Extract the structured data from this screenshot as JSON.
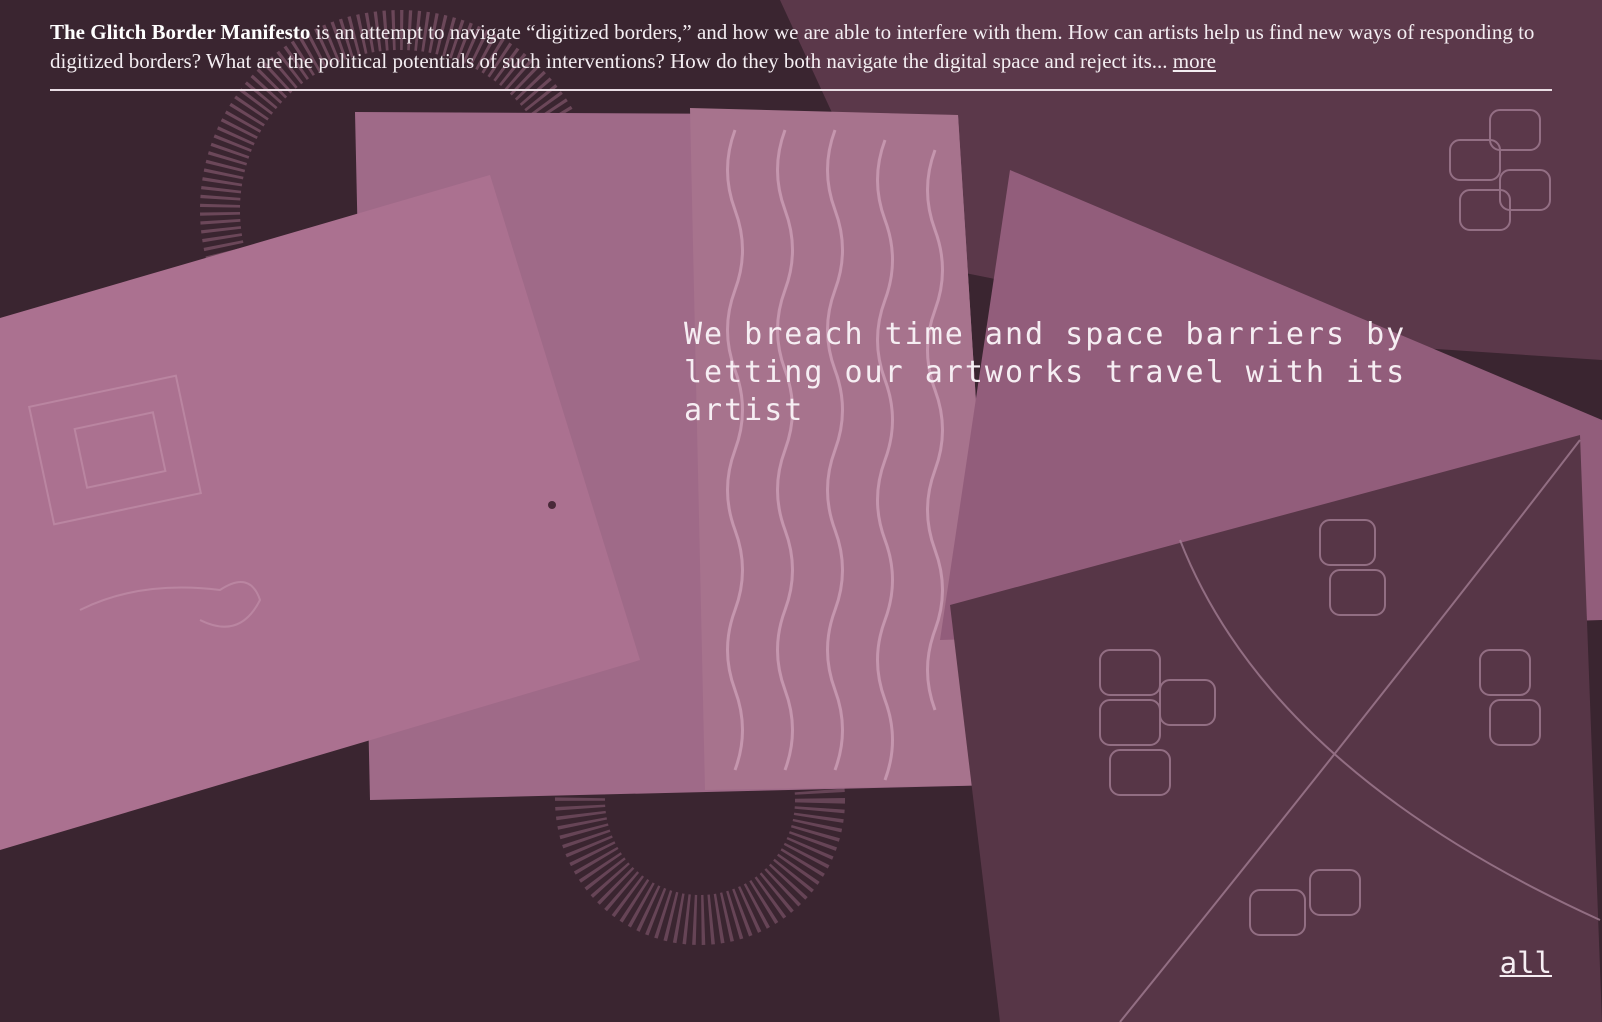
{
  "intro": {
    "title": "The Glitch Border Manifesto",
    "text": " is an attempt to navigate “digitized borders,” and how we are able to interfere with them. How can artists help us find new ways of responding to digitized borders? What are the political potentials of such interventions? How do they both navigate the digital space and reject its... ",
    "more_label": "more"
  },
  "quote": {
    "text": "We breach time and space barriers by letting our artworks travel with its artist"
  },
  "nav": {
    "all_label": "all"
  },
  "colors": {
    "background": "#3a2530",
    "paper_pink": "#b47897",
    "text": "#f4eef2"
  }
}
